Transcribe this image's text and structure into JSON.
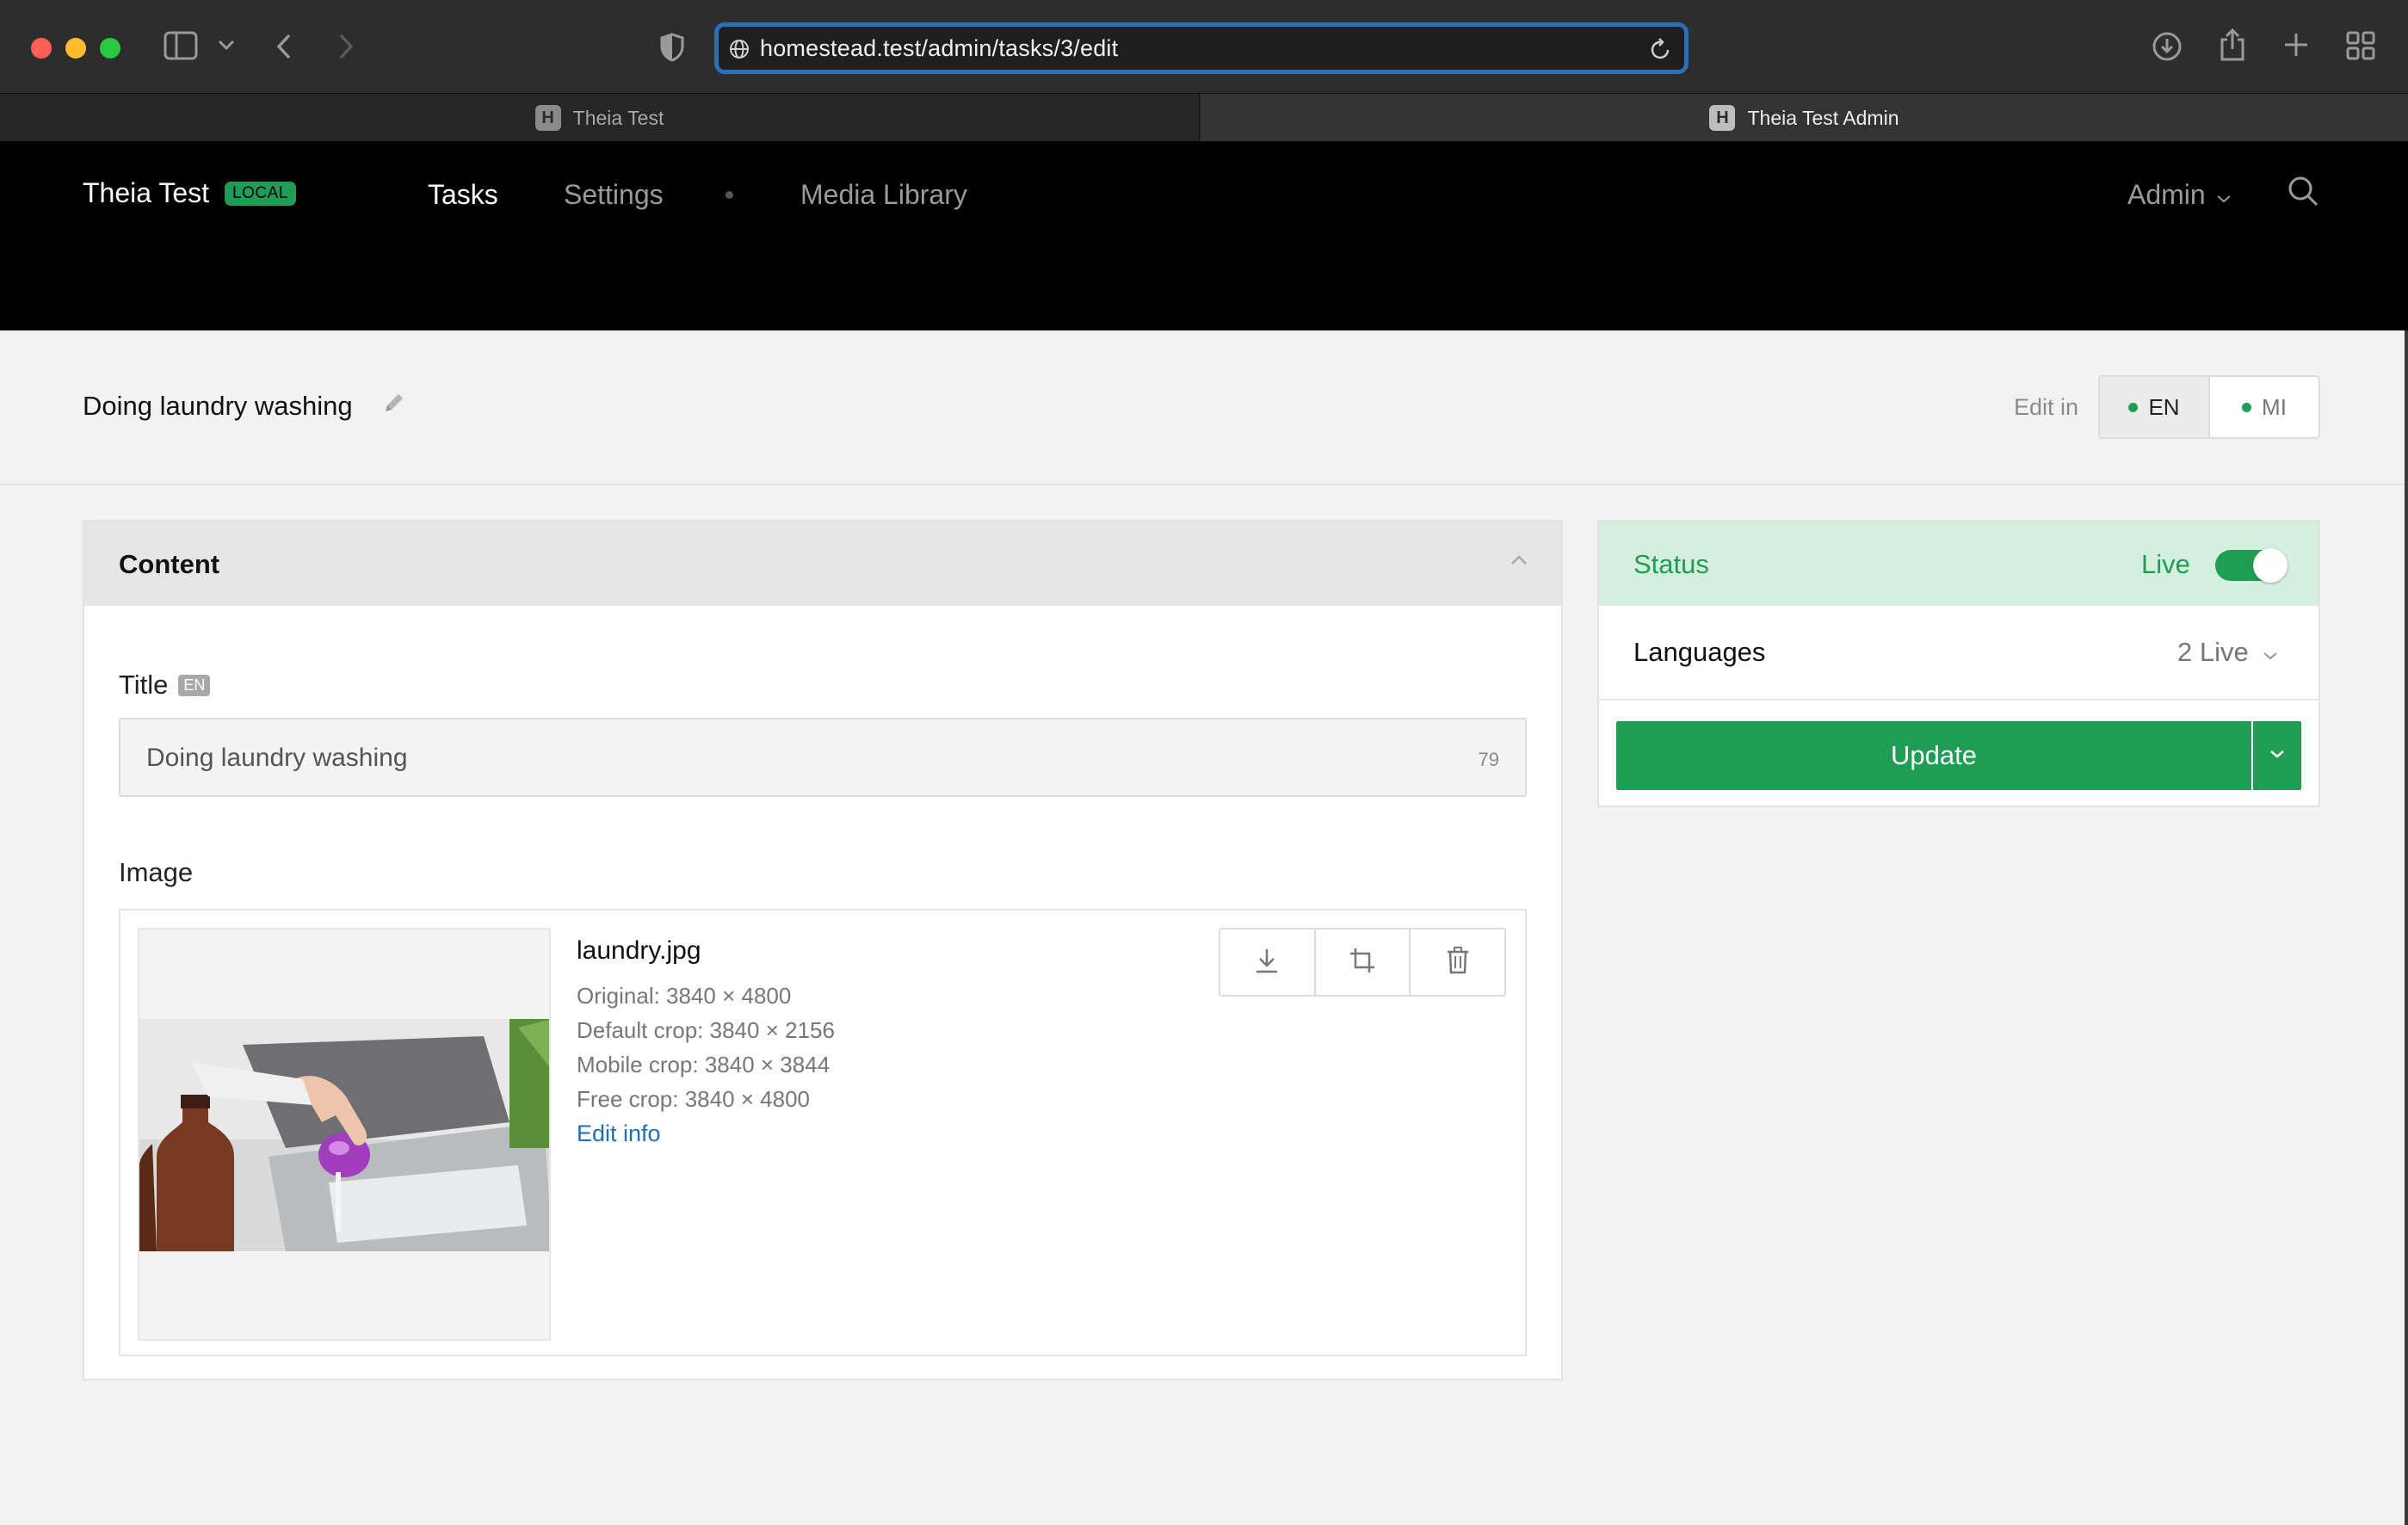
{
  "browser": {
    "url": "homestead.test/admin/tasks/3/edit",
    "tabs": [
      {
        "label": "Theia Test",
        "favicon": "H",
        "active": false
      },
      {
        "label": "Theia Test Admin",
        "favicon": "H",
        "active": true
      }
    ],
    "icons": [
      "sidebar-icon",
      "chevron-down-icon",
      "back-icon",
      "forward-icon",
      "shield-icon",
      "globe-icon",
      "reload-icon",
      "download-icon",
      "share-icon",
      "new-tab-icon",
      "tab-overview-icon"
    ]
  },
  "header": {
    "brand": "Theia Test",
    "env_badge": "LOCAL",
    "nav": {
      "tasks": "Tasks",
      "settings": "Settings",
      "media_library": "Media Library"
    },
    "user_menu": "Admin"
  },
  "titlebar": {
    "title": "Doing laundry washing",
    "edit_in_label": "Edit in",
    "languages": [
      {
        "code": "EN",
        "active": true
      },
      {
        "code": "MI",
        "active": false
      }
    ]
  },
  "content_panel": {
    "heading": "Content",
    "title_field": {
      "label": "Title",
      "lang_badge": "EN",
      "value": "Doing laundry washing",
      "char_count": "79"
    },
    "image_field": {
      "label": "Image",
      "file_name": "laundry.jpg",
      "original": "Original: 3840 × 4800",
      "default_crop": "Default crop: 3840 × 2156",
      "mobile_crop": "Mobile crop: 3840 × 3844",
      "free_crop": "Free crop: 3840 × 4800",
      "edit_info": "Edit info"
    }
  },
  "side_panel": {
    "status_label": "Status",
    "status_value": "Live",
    "status_on": true,
    "languages_label": "Languages",
    "languages_value": "2 Live",
    "update_label": "Update"
  },
  "colors": {
    "accent_green": "#1f9d55",
    "status_bg": "#d4efdd",
    "link_blue": "#1f6fb8",
    "url_focus": "#2a6fb8"
  }
}
